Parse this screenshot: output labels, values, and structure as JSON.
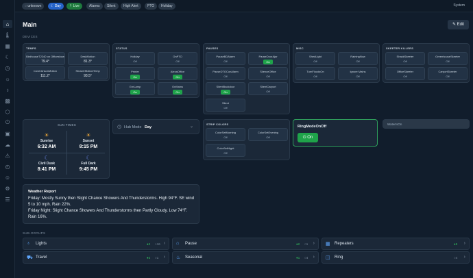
{
  "topbar": {
    "pills": [
      "unknown",
      "Day",
      "Live",
      "Alarms",
      "Silent",
      "High Alert",
      "PTO",
      "Holiday"
    ],
    "system": "System"
  },
  "page": {
    "title": "Main",
    "edit": "Edit",
    "devices_label": "DEVICES",
    "subgroups_label": "SUB-GROUPS"
  },
  "temps": {
    "title": "TEMPS",
    "tiles": [
      {
        "name": "BirdhouseT2240 on Officeshow",
        "value": "79.4°"
      },
      {
        "name": "DeskMotion",
        "value": "81.3°"
      },
      {
        "name": "CoverAnsonMotion",
        "value": "111.2°"
      },
      {
        "name": "ShowerMotionTemp",
        "value": "93.5°"
      }
    ]
  },
  "status": {
    "title": "STATUS",
    "tiles": [
      {
        "name": "Holiday",
        "value": "Off"
      },
      {
        "name": "OnPTO",
        "value": "Off"
      },
      {
        "name": "Printer",
        "value": "On"
      },
      {
        "name": "AlexaOffice",
        "value": "On"
      },
      {
        "name": "GrnLamp",
        "value": "On"
      },
      {
        "name": "OnMains",
        "value": "On"
      }
    ]
  },
  "pauses": {
    "title": "PAUSES",
    "tiles": [
      {
        "name": "PauseBDAlarm",
        "value": "Off"
      },
      {
        "name": "PauseDoorAjar",
        "value": "On"
      },
      {
        "name": "PauseDTOConAlarm",
        "value": "Off"
      },
      {
        "name": "SilenceOffice",
        "value": "Off"
      },
      {
        "name": "SilentBackdoor",
        "value": "On"
      },
      {
        "name": "SilentCarport",
        "value": "Off"
      },
      {
        "name": "Silent",
        "value": "Off"
      }
    ]
  },
  "misc": {
    "title": "MISC",
    "tiles": [
      {
        "name": "ShedLight",
        "value": "Off"
      },
      {
        "name": "RainingNow",
        "value": "Off"
      },
      {
        "name": "TurnFloodsOn",
        "value": "Off"
      },
      {
        "name": "Ignore Mains",
        "value": "Off"
      }
    ]
  },
  "skeeter": {
    "title": "SKEETER KILLERS",
    "tiles": [
      {
        "name": "ShackSkeeter",
        "value": "Off"
      },
      {
        "name": "GreenhouseSkeeter",
        "value": "Off"
      },
      {
        "name": "OfficeSkeeter",
        "value": "Off"
      },
      {
        "name": "CarportSkeeter",
        "value": "Off"
      }
    ]
  },
  "suntimes": {
    "title": "SUN TIMES",
    "items": [
      {
        "label": "Sunrise",
        "time": "6:32 AM",
        "icon": "sunrise-icon"
      },
      {
        "label": "Sunset",
        "time": "8:15 PM",
        "icon": "sunset-icon"
      },
      {
        "label": "Civil Dusk",
        "time": "8:41 PM",
        "icon": "moon-icon"
      },
      {
        "label": "Full Dark",
        "time": "9:45 PM",
        "icon": "moon-icon"
      }
    ]
  },
  "hubmode": {
    "label": "Hub Mode",
    "value": "Day"
  },
  "stripcolors": {
    "title": "STRIP COLORS",
    "tiles": [
      {
        "name": "ColorSetMorning",
        "value": "Off"
      },
      {
        "name": "ColorSetEvening",
        "value": "Off"
      },
      {
        "name": "ColorSetNight",
        "value": "Off"
      }
    ]
  },
  "ringmode": {
    "name": "RingModeOnOff",
    "button": "On"
  },
  "waterison": {
    "name": "WaterIsOn"
  },
  "weather": {
    "title": "Weather Report",
    "text": "Friday: Mostly Sunny then Slight Chance Showers And Thunderstorms. High 94°F. SE wind 5 to 10 mph. Rain 22%.\nFriday Night: Slight Chance Showers And Thunderstorms then Partly Cloudy. Low 74°F. Rain 16%."
  },
  "subgroups": [
    {
      "name": "Lights",
      "on": "2",
      "off": "16"
    },
    {
      "name": "Pause",
      "on": "2",
      "off": "1"
    },
    {
      "name": "Repeaters",
      "on": "5",
      "off": ""
    },
    {
      "name": "Travel",
      "on": "2",
      "off": "1"
    },
    {
      "name": "Seasonal",
      "on": "1",
      "off": "4"
    },
    {
      "name": "Ring",
      "on": "",
      "off": "4"
    }
  ],
  "colors": {
    "accent": "#2563c9",
    "on": "#1fa34a",
    "ringborder": "#2f9e5c",
    "bg": "#111d2c"
  }
}
